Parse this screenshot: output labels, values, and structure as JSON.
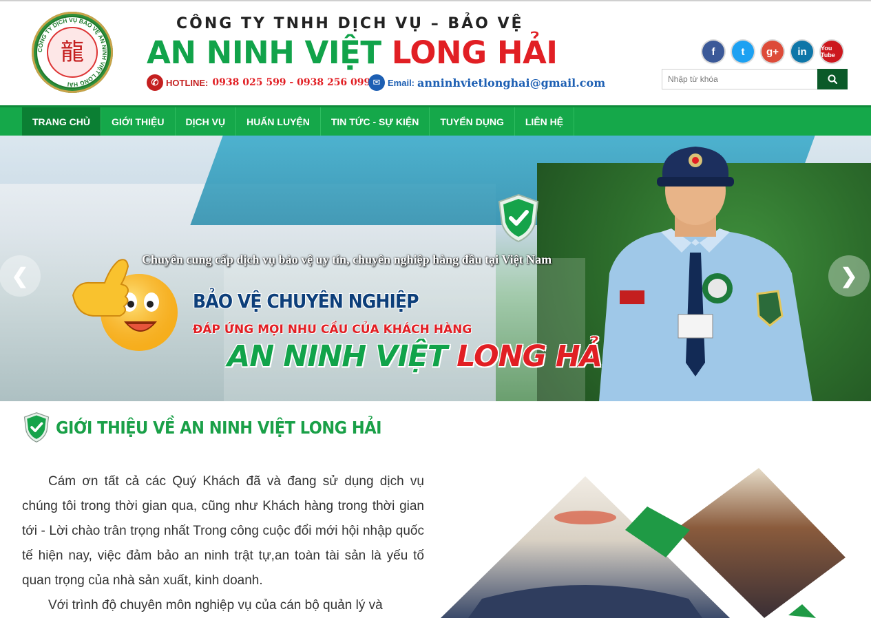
{
  "header": {
    "company_line": "CÔNG TY TNHH DỊCH VỤ – BẢO VỆ",
    "brand_green": "AN NINH VIỆT ",
    "brand_red": "LONG HẢI",
    "hotline_label": "HOTLINE:",
    "hotline_numbers": "0938 025 599 - 0938 256 099",
    "email_label": "Email:",
    "email_address": "anninhvietlonghai@gmail.com",
    "logo_icon": "company-seal-logo",
    "logo_text": "CÔNG TY DỊCH VỤ BẢO VỆ AN NINH VIỆT LONG HẢI"
  },
  "socials": [
    {
      "name": "facebook",
      "glyph": "f"
    },
    {
      "name": "twitter",
      "glyph": "t"
    },
    {
      "name": "google-plus",
      "glyph": "g+"
    },
    {
      "name": "linkedin",
      "glyph": "in"
    },
    {
      "name": "youtube",
      "glyph": "You Tube"
    }
  ],
  "search": {
    "placeholder": "Nhập từ khóa",
    "icon": "search-icon"
  },
  "nav": {
    "items": [
      {
        "label": "TRANG CHỦ",
        "active": true
      },
      {
        "label": "GIỚI THIỆU",
        "active": false
      },
      {
        "label": "DỊCH VỤ",
        "active": false
      },
      {
        "label": "HUẤN LUYỆN",
        "active": false
      },
      {
        "label": "TIN TỨC - SỰ KIỆN",
        "active": false
      },
      {
        "label": "TUYỂN DỤNG",
        "active": false
      },
      {
        "label": "LIÊN HỆ",
        "active": false
      }
    ]
  },
  "slider": {
    "tagline": "Chuyên cung cấp dịch vụ bảo vệ uy tín, chuyên nghiệp hàng đầu tại Việt Nam",
    "headline": "BẢO VỆ CHUYÊN NGHIỆP",
    "subheadline": "ĐÁP ỨNG MỌI NHU CẦU CỦA KHÁCH HÀNG",
    "brand_green": "AN NINH VIỆT ",
    "brand_red": "LONG HẢI",
    "prev_glyph": "❮",
    "next_glyph": "❯"
  },
  "intro": {
    "title": "GIỚI THIỆU VỀ AN NINH VIỆT LONG HẢI",
    "paragraphs": [
      "Cám ơn tất cả các Quý Khách đã và đang sử dụng dịch vụ chúng tôi trong thời gian qua, cũng như Khách hàng trong thời gian tới - Lời chào trân trọng nhất Trong công cuộc đổi mới hội nhập quốc tế hiện nay, việc đảm bảo an ninh trật tự,an toàn tài sản là yếu tố quan trọng của nhà sản xuất, kinh doanh.",
      "Với trình độ chuyên môn nghiệp vụ của cán bộ quản lý và"
    ]
  },
  "colors": {
    "brand_green": "#11a34a",
    "brand_red": "#e11f24",
    "nav_bg": "#15a84a",
    "nav_active": "#0b7f33",
    "search_button": "#0b5a29"
  }
}
